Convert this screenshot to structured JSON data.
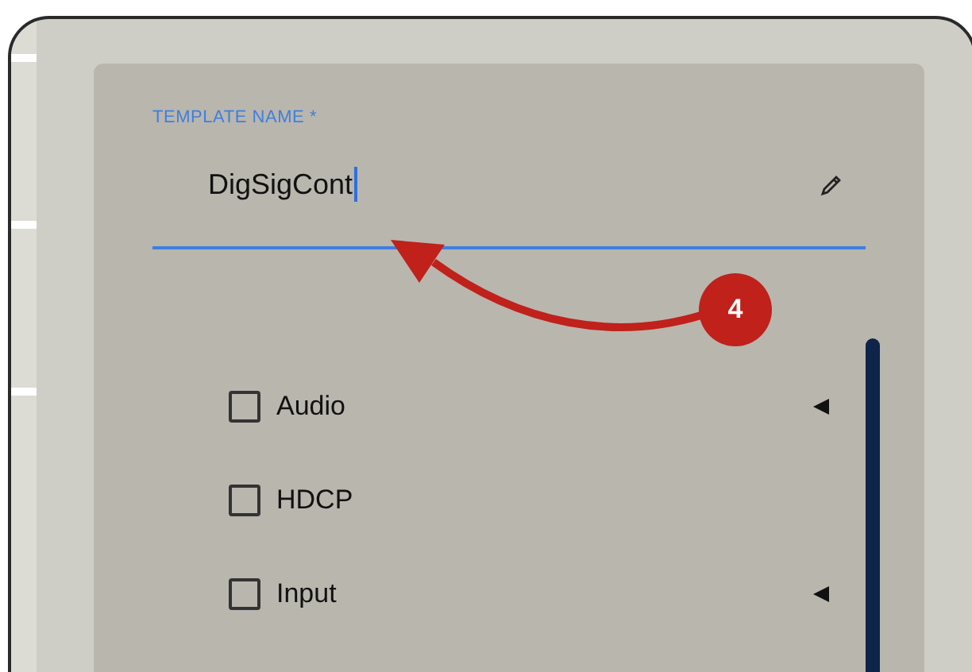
{
  "field": {
    "label": "TEMPLATE NAME *",
    "value": "DigSigCont"
  },
  "annotation": {
    "step": "4"
  },
  "options": [
    {
      "label": "Audio",
      "checked": false,
      "expandable": true
    },
    {
      "label": "HDCP",
      "checked": false,
      "expandable": false
    },
    {
      "label": "Input",
      "checked": false,
      "expandable": true
    }
  ]
}
